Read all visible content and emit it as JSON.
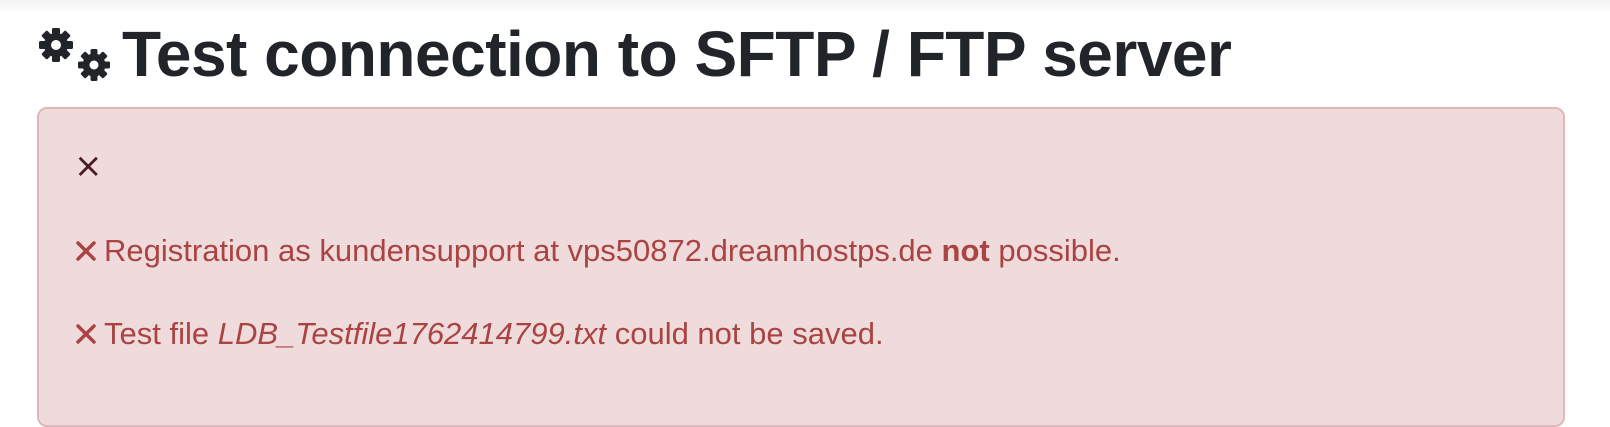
{
  "header": {
    "title": "Test connection to SFTP / FTP server",
    "icon": "gears-icon"
  },
  "alert": {
    "close_label": "×",
    "colors": {
      "background": "#f0dbdc",
      "border": "#e0b7ba",
      "text": "#a94442"
    },
    "messages": [
      {
        "icon": "x-mark-icon",
        "part1": "Registration as kundensupport at vps50872.dreamhostps.de ",
        "emphasis": "not",
        "part2": " possible."
      },
      {
        "icon": "x-mark-icon",
        "part1": "Test file ",
        "emphasis": "LDB_Testfile1762414799.txt",
        "part2": " could not be saved."
      }
    ]
  }
}
